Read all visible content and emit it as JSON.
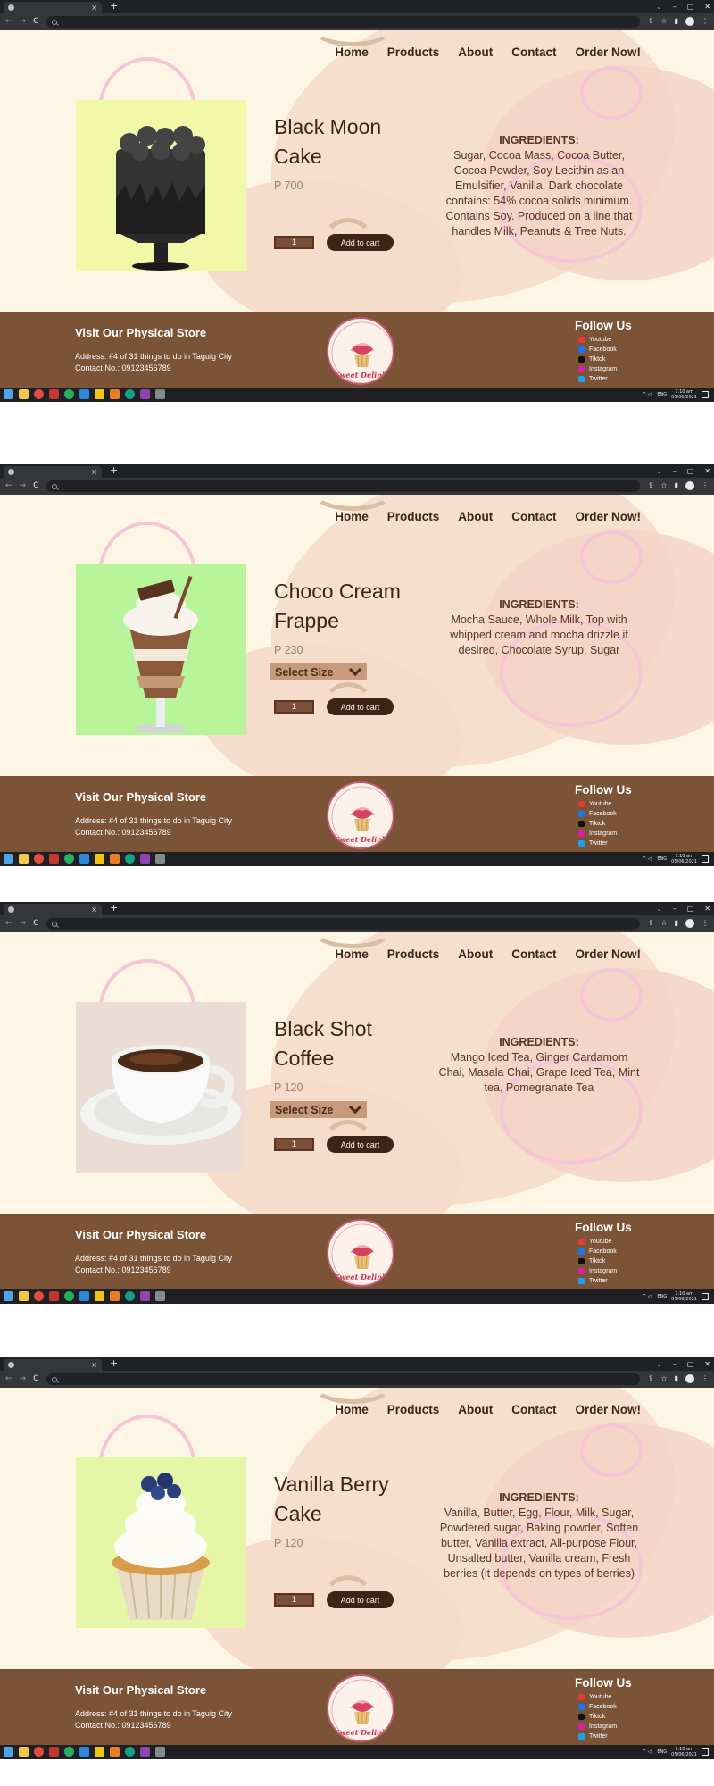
{
  "browser": {
    "new_tab": "+",
    "tab_close": "×",
    "window_controls": [
      "⌄",
      "–",
      "▢",
      "✕"
    ],
    "nav_buttons": [
      "←",
      "→",
      "C"
    ],
    "toolbar_icons": [
      "⇪",
      "☆",
      "▮",
      "⋮"
    ]
  },
  "nav": [
    "Home",
    "Products",
    "About",
    "Contact",
    "Order Now!"
  ],
  "footer": {
    "visit_title": "Visit Our Physical Store",
    "address": "Address: #4 of 31 things to do in Taguig City",
    "contact": "Contact No.: 09123456789",
    "follow_title": "Follow Us",
    "socials": [
      {
        "name": "Youtube",
        "color": "#e53935"
      },
      {
        "name": "Facebook",
        "color": "#1877f2"
      },
      {
        "name": "Tiktok",
        "color": "#111111"
      },
      {
        "name": "Instagram",
        "color": "#d6249f"
      },
      {
        "name": "Twitter",
        "color": "#1da1f2"
      }
    ]
  },
  "taskbar": {
    "lang": "ENG",
    "time": "7:10 am",
    "date": "05/06/2021",
    "tray": "^ ◁) "
  },
  "logo_text": "Sweet Delight",
  "add_to_cart": "Add to cart",
  "select_size": "Select Size",
  "ingredients_title": "INGREDIENTS:",
  "screens": [
    {
      "name": "Black Moon Cake",
      "price": "P 700",
      "qty": "1",
      "has_size": false,
      "bg": "#f1f8a8",
      "ingredients": "Sugar, Cocoa Mass, Cocoa Butter, Cocoa Powder, Soy Lecithin as an Emulsifier, Vanilla. Dark chocolate contains: 54% cocoa solids minimum. Contains Soy. Produced on a line that handles Milk, Peanuts & Tree Nuts."
    },
    {
      "name": "Choco Cream Frappe",
      "price": "P 230",
      "qty": "1",
      "has_size": true,
      "bg": "#b8f59a",
      "ingredients": "Mocha Sauce, Whole Milk, Top with whipped cream and mocha drizzle if desired, Chocolate Syrup, Sugar"
    },
    {
      "name": "Black Shot Coffee",
      "price": "P 120",
      "qty": "1",
      "has_size": true,
      "bg": "#ecdcd6",
      "ingredients": "Mango Iced Tea, Ginger Cardamom Chai, Masala Chai, Grape Iced Tea, Mint tea, Pomegranate Tea"
    },
    {
      "name": "Vanilla Berry Cake",
      "price": "P 120",
      "qty": "1",
      "has_size": false,
      "bg": "#e5f7a6",
      "ingredients": "Vanilla, Butter, Egg, Flour, Milk, Sugar, Powdered sugar, Baking powder, Soften butter, Vanilla extract, All-purpose Flour, Unsalted butter, Vanilla cream, Fresh berries (it depends on types of berries)"
    }
  ]
}
